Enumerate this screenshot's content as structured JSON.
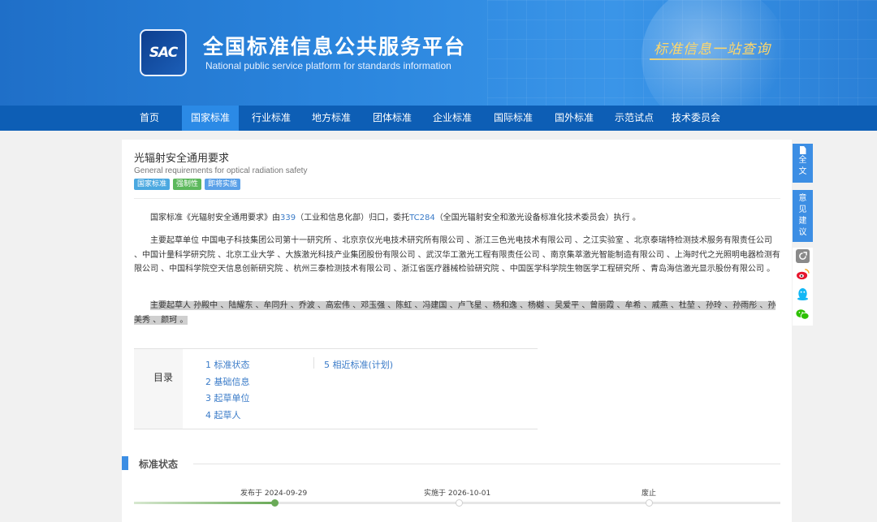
{
  "header": {
    "logo_text": "SAC",
    "title": "全国标准信息公共服务平台",
    "subtitle": "National public service platform  for standards information",
    "slogan": "标准信息一站查询"
  },
  "nav": {
    "items": [
      "首页",
      "国家标准",
      "行业标准",
      "地方标准",
      "团体标准",
      "企业标准",
      "国际标准",
      "国外标准",
      "示范试点",
      "技术委员会"
    ],
    "active": "国家标准"
  },
  "standard": {
    "title": "光辐射安全通用要求",
    "title_en": "General requirements for optical radiation safety",
    "tags": [
      "国家标准",
      "强制性",
      "即将实施"
    ]
  },
  "intro": {
    "p1_prefix": "国家标准《光辐射安全通用要求》由",
    "p1_link1": "339",
    "p1_mid": "（工业和信息化部）归口，委托",
    "p1_link2": "TC284",
    "p1_suffix": "（全国光辐射安全和激光设备标准化技术委员会）执行 。",
    "p2": "主要起草单位 中国电子科技集团公司第十一研究所 、北京京仪光电技术研究所有限公司 、浙江三色光电技术有限公司 、之江实验室 、北京泰瑞特检测技术服务有限责任公司 、中国计量科学研究院 、北京工业大学 、大族激光科技产业集团股份有限公司 、武汉华工激光工程有限责任公司 、南京集萃激光智能制造有限公司 、上海时代之光照明电器检测有限公司 、中国科学院空天信息创新研究院 、杭州三泰检测技术有限公司 、浙江省医疗器械检验研究院 、中国医学科学院生物医学工程研究所 、青岛海信激光显示股份有限公司 。",
    "p3": "主要起草人 孙殿中 、陆耀东 、牟同升 、乔波 、高宏伟 、邓玉强 、陈虹 、冯建国 、卢飞星 、杨和逸 、杨樾 、吴爱平 、曾丽霞 、牟希 、戚燕 、杜堃 、孙玲 、孙雨彤 、孙美秀 、颜珂 。"
  },
  "toc": {
    "label": "目录",
    "col1": [
      "1  标准状态",
      "2  基础信息",
      "3  起草单位",
      "4  起草人"
    ],
    "col2": [
      "5  相近标准(计划)"
    ]
  },
  "status": {
    "section_title": "标准状态",
    "published": "发布于 2024-09-29",
    "effective": "实施于 2026-10-01",
    "abolished": "废止",
    "progress_stage": 1
  },
  "float_bar": {
    "fulltext": "全文",
    "feedback": "意见建议",
    "icons": [
      "share-icon",
      "weibo-icon",
      "qq-icon",
      "wechat-icon"
    ]
  },
  "colors": {
    "brand_blue": "#0d5eb5",
    "active_nav": "#2b8ae6",
    "link": "#3a7bc8",
    "progress_green": "#6aaa58"
  }
}
